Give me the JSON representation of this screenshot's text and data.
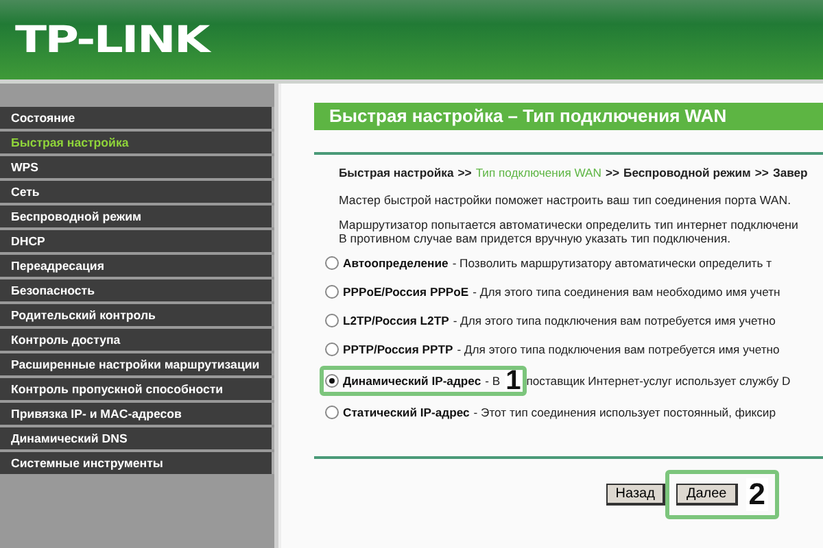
{
  "header": {
    "logo": "TP-LINK"
  },
  "sidebar": {
    "items": [
      {
        "label": "Состояние",
        "selected": false
      },
      {
        "label": "Быстрая настройка",
        "selected": true
      },
      {
        "label": "WPS",
        "selected": false
      },
      {
        "label": "Сеть",
        "selected": false
      },
      {
        "label": "Беспроводной режим",
        "selected": false
      },
      {
        "label": "DHCP",
        "selected": false
      },
      {
        "label": "Переадресация",
        "selected": false
      },
      {
        "label": "Безопасность",
        "selected": false
      },
      {
        "label": "Родительский контроль",
        "selected": false
      },
      {
        "label": "Контроль доступа",
        "selected": false
      },
      {
        "label": "Расширенные настройки маршрутизации",
        "selected": false
      },
      {
        "label": "Контроль пропускной способности",
        "selected": false
      },
      {
        "label": "Привязка IP- и MAC-адресов",
        "selected": false
      },
      {
        "label": "Динамический DNS",
        "selected": false
      },
      {
        "label": "Системные инструменты",
        "selected": false
      }
    ]
  },
  "main": {
    "title": "Быстрая настройка – Тип подключения WAN",
    "breadcrumb": [
      {
        "label": "Быстрая настройка",
        "selected": false
      },
      {
        "label": "Тип подключения WAN",
        "selected": true
      },
      {
        "label": "Беспроводной режим",
        "selected": false
      },
      {
        "label": "Завер",
        "selected": false
      }
    ],
    "breadcrumb_separator": ">>",
    "intro": "Мастер быстрой настройки поможет настроить ваш тип соединения порта WAN.",
    "note_lines": [
      "Маршрутизатор попытается автоматически определить тип интернет подключени",
      "В противном случае вам придется вручную указать тип подключения."
    ],
    "options": [
      {
        "name": "Автоопределение",
        "description": "- Позволить маршрутизатору автоматически определить т",
        "selected": false
      },
      {
        "name": "PPPoE/Россия PPPoE",
        "description": "- Для этого типа соединения вам необходимо имя учетн",
        "selected": false
      },
      {
        "name": "L2TP/Россия L2TP",
        "description": "- Для этого типа подключения вам потребуется имя учетно",
        "selected": false
      },
      {
        "name": "PPTP/Россия PPTP",
        "description": "- Для этого типа подключения вам потребуется имя учетно",
        "selected": false
      },
      {
        "name": "Динамический IP-адрес",
        "description": "- В",
        "selected": true,
        "callout": "1",
        "description_after": "поставщик Интернет-услуг использует службу D"
      },
      {
        "name": "Статический IP-адрес",
        "description": "- Этот тип соединения использует постоянный, фиксир",
        "selected": false
      }
    ],
    "buttons": [
      {
        "label": "Назад"
      },
      {
        "label": "Далее",
        "callout": "2"
      }
    ]
  }
}
